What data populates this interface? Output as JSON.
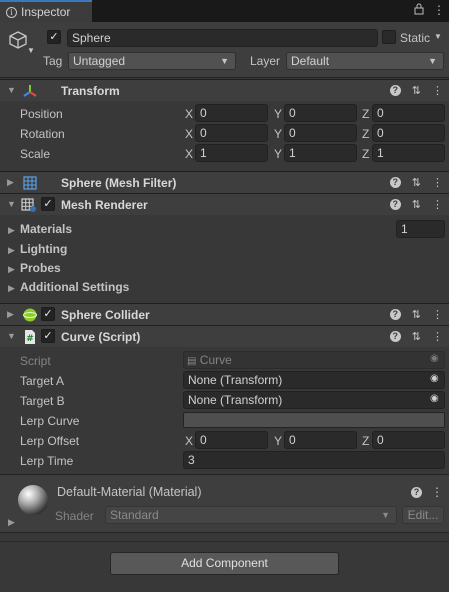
{
  "tab": {
    "label": "Inspector"
  },
  "object": {
    "name": "Sphere",
    "static_label": "Static",
    "tag_label": "Tag",
    "tag_value": "Untagged",
    "layer_label": "Layer",
    "layer_value": "Default"
  },
  "transform": {
    "title": "Transform",
    "rows": [
      {
        "label": "Position",
        "x": "0",
        "y": "0",
        "z": "0"
      },
      {
        "label": "Rotation",
        "x": "0",
        "y": "0",
        "z": "0"
      },
      {
        "label": "Scale",
        "x": "1",
        "y": "1",
        "z": "1"
      }
    ]
  },
  "axes": {
    "x": "X",
    "y": "Y",
    "z": "Z"
  },
  "mesh_filter": {
    "title": "Sphere (Mesh Filter)"
  },
  "mesh_renderer": {
    "title": "Mesh Renderer",
    "materials_label": "Materials",
    "materials_count": "1",
    "lighting_label": "Lighting",
    "probes_label": "Probes",
    "additional_label": "Additional Settings"
  },
  "sphere_collider": {
    "title": "Sphere Collider"
  },
  "curve_script": {
    "title": "Curve (Script)",
    "script_label": "Script",
    "script_value": "Curve",
    "target_a_label": "Target A",
    "target_a_value": "None (Transform)",
    "target_b_label": "Target B",
    "target_b_value": "None (Transform)",
    "lerp_curve_label": "Lerp Curve",
    "lerp_offset_label": "Lerp Offset",
    "lerp_offset": {
      "x": "0",
      "y": "0",
      "z": "0"
    },
    "lerp_time_label": "Lerp Time",
    "lerp_time_value": "3"
  },
  "material": {
    "title": "Default-Material (Material)",
    "shader_label": "Shader",
    "shader_value": "Standard",
    "edit_label": "Edit..."
  },
  "add_component_label": "Add Component"
}
